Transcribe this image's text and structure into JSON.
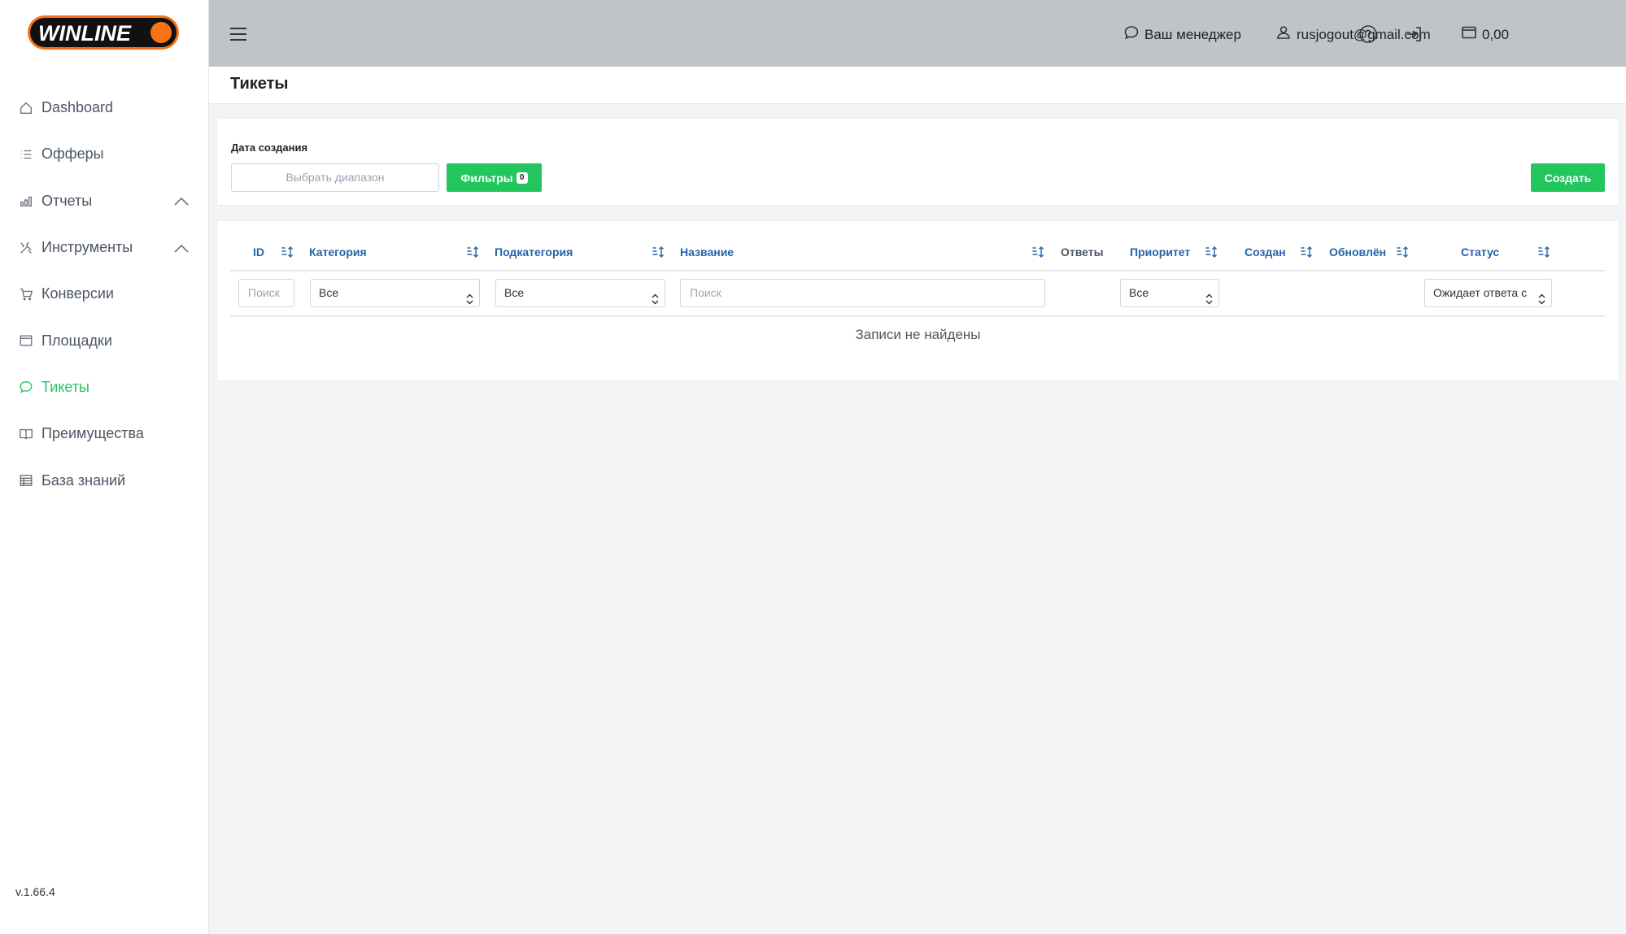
{
  "brand": {
    "logo_text": "WINLINE",
    "accent": "#22c55e",
    "logo_orange": "#f97316"
  },
  "sidebar": {
    "items": [
      {
        "label": "Dashboard",
        "icon": "home-icon"
      },
      {
        "label": "Офферы",
        "icon": "list-icon"
      },
      {
        "label": "Отчеты",
        "icon": "bar-chart-icon",
        "expandable": true
      },
      {
        "label": "Инструменты",
        "icon": "tools-icon",
        "expandable": true
      },
      {
        "label": "Конверсии",
        "icon": "cart-icon"
      },
      {
        "label": "Площадки",
        "icon": "browser-window-icon"
      },
      {
        "label": "Тикеты",
        "icon": "chat-icon",
        "active": true
      },
      {
        "label": "Преимущества",
        "icon": "book-icon"
      },
      {
        "label": "База знаний",
        "icon": "table-icon"
      }
    ],
    "version": "v.1.66.4"
  },
  "topbar": {
    "manager_label": "Ваш менеджер",
    "user_email": "rusjogout@gmail.com",
    "balance": "0,00"
  },
  "page": {
    "title": "Тикеты"
  },
  "filters": {
    "date_label": "Дата создания",
    "range_placeholder": "Выбрать диапазон",
    "filters_button": "Фильтры",
    "filters_count": "0",
    "create_button": "Создать"
  },
  "table": {
    "columns": {
      "id": "ID",
      "category": "Категория",
      "subcategory": "Подкатегория",
      "name": "Название",
      "answers": "Ответы",
      "priority": "Приоритет",
      "created": "Создан",
      "updated": "Обновлён",
      "status": "Статус"
    },
    "row_filters": {
      "id_placeholder": "Поиск",
      "category_value": "Все",
      "subcategory_value": "Все",
      "name_placeholder": "Поиск",
      "priority_value": "Все",
      "status_value": "Ожидает ответа с"
    },
    "empty_message": "Записи не найдены"
  }
}
